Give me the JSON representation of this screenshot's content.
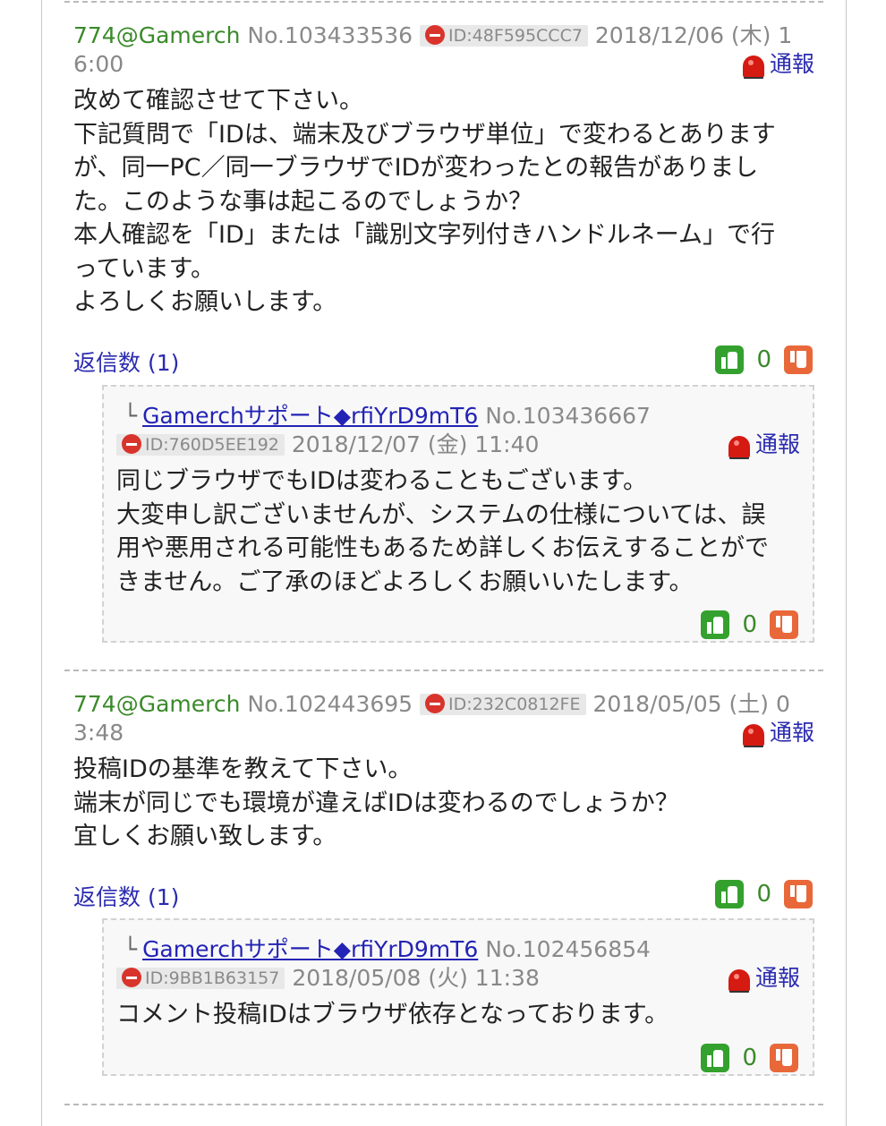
{
  "posts": [
    {
      "author": "774@Gamerch",
      "number": "No.103433536",
      "id": "ID:48F595CCC7",
      "date": "2018/12/06 (木) 16:00",
      "report": "通報",
      "body": "改めて確認させて下さい。\n下記質問で「IDは、端末及びブラウザ単位」で変わるとあります\nが、同一PC／同一ブラウザでIDが変わったとの報告がありまし\nた。このような事は起こるのでしょうか？\n本人確認を「ID」または「識別文字列付きハンドルネーム」で行\nっています。\nよろしくお願いします。",
      "reply_count": "返信数 (1)",
      "likes": "0",
      "reply": {
        "corner": "└",
        "author": "Gamerchサポート◆rfiYrD9mT6",
        "number": "No.103436667",
        "id": "ID:760D5EE192",
        "date": "2018/12/07 (金) 11:40",
        "report": "通報",
        "body": "同じブラウザでもIDは変わることもございます。\n大変申し訳ございませんが、システムの仕様については、誤\n用や悪用される可能性もあるため詳しくお伝えすることがで\nきません。ご了承のほどよろしくお願いいたします。",
        "likes": "0"
      }
    },
    {
      "author": "774@Gamerch",
      "number": "No.102443695",
      "id": "ID:232C0812FE",
      "date": "2018/05/05 (土) 03:48",
      "report": "通報",
      "body": "投稿IDの基準を教えて下さい。\n端末が同じでも環境が違えばIDは変わるのでしょうか？\n宜しくお願い致します。",
      "reply_count": "返信数 (1)",
      "likes": "0",
      "reply": {
        "corner": "└",
        "author": "Gamerchサポート◆rfiYrD9mT6",
        "number": "No.102456854",
        "id": "ID:9BB1B63157",
        "date": "2018/05/08 (火) 11:38",
        "report": "通報",
        "body": "コメント投稿IDはブラウザ依存となっております。",
        "likes": "0"
      }
    }
  ],
  "icons": {
    "thumb_up": "thumbs-up-icon",
    "thumb_down": "thumbs-down-icon",
    "report": "siren-icon",
    "id_mark": "minus-circle-icon"
  },
  "colors": {
    "author_green": "#3a8a2a",
    "link_blue": "#2b2bb0",
    "up_green": "#34a12e",
    "down_orange": "#e8683a",
    "siren_red": "#d51a12"
  }
}
